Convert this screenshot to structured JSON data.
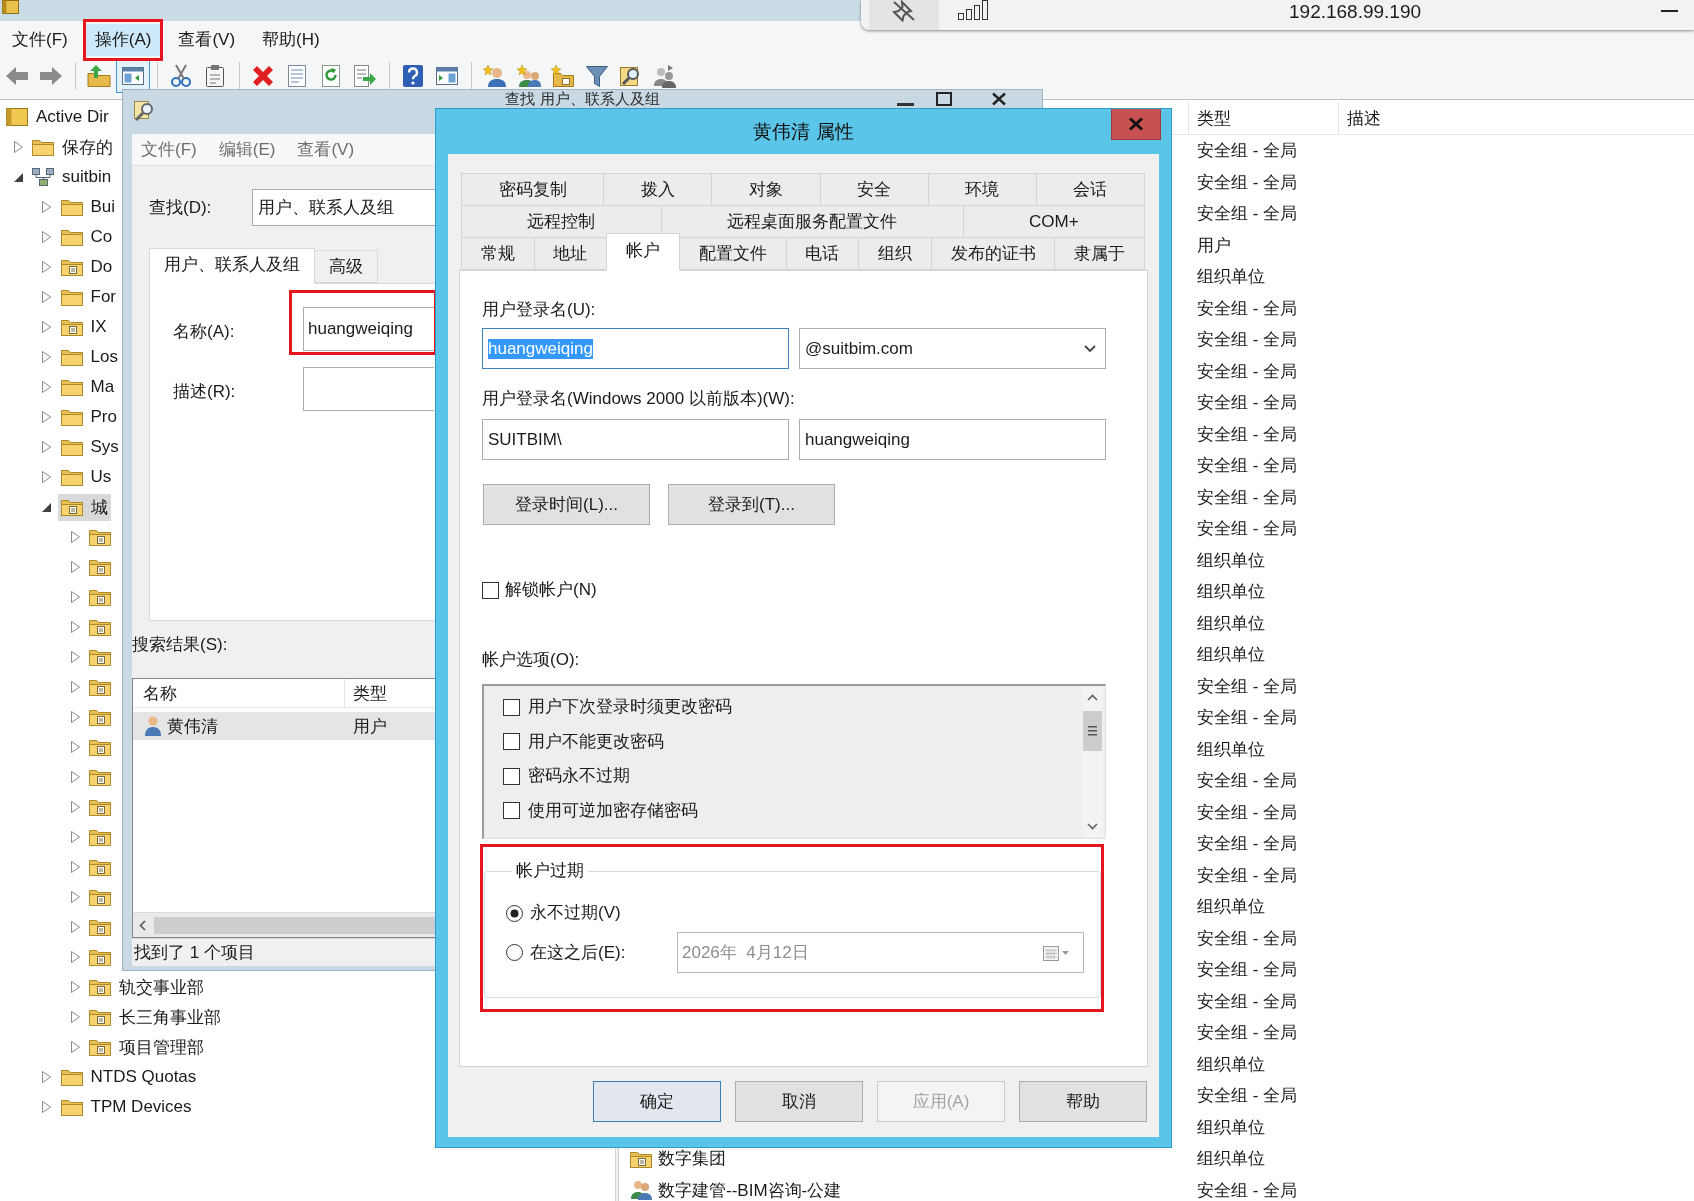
{
  "remote_bar": {
    "address": "192.168.99.190"
  },
  "menu": [
    {
      "label": "文件(F)",
      "selected": false,
      "annotated": false
    },
    {
      "label": "操作(A)",
      "selected": true,
      "annotated": true
    },
    {
      "label": "查看(V)",
      "selected": false,
      "annotated": false
    },
    {
      "label": "帮助(H)",
      "selected": false,
      "annotated": false
    }
  ],
  "toolbar": [
    {
      "kind": "back",
      "pressed": false
    },
    {
      "kind": "forward",
      "pressed": false
    },
    {
      "kind": "separator"
    },
    {
      "kind": "up",
      "pressed": false
    },
    {
      "kind": "tree",
      "pressed": true
    },
    {
      "kind": "separator"
    },
    {
      "kind": "cut",
      "pressed": false
    },
    {
      "kind": "paste",
      "pressed": false
    },
    {
      "kind": "separator"
    },
    {
      "kind": "delete",
      "pressed": false
    },
    {
      "kind": "properties",
      "pressed": false
    },
    {
      "kind": "refresh",
      "pressed": false
    },
    {
      "kind": "export",
      "pressed": false
    },
    {
      "kind": "separator"
    },
    {
      "kind": "help",
      "pressed": false
    },
    {
      "kind": "actionpane",
      "pressed": false
    },
    {
      "kind": "separator"
    },
    {
      "kind": "newuser",
      "pressed": false
    },
    {
      "kind": "newgroup",
      "pressed": false
    },
    {
      "kind": "newou",
      "pressed": false
    },
    {
      "kind": "filter",
      "pressed": false
    },
    {
      "kind": "find",
      "pressed": false
    },
    {
      "kind": "delegate",
      "pressed": false
    }
  ],
  "tree": [
    {
      "label": "Active Dir",
      "kind": "book",
      "selected": false,
      "children": [
        {
          "label": "保存的",
          "kind": "folder",
          "expanded": false,
          "selected": false
        },
        {
          "label": "suitbin",
          "kind": "domain",
          "expanded": true,
          "selected": false,
          "children": [
            {
              "label": "Bui",
              "kind": "folder",
              "expanded": false,
              "selected": false
            },
            {
              "label": "Co",
              "kind": "folder",
              "expanded": false,
              "selected": false
            },
            {
              "label": "Do",
              "kind": "ou",
              "expanded": false,
              "selected": false
            },
            {
              "label": "For",
              "kind": "folder",
              "expanded": false,
              "selected": false
            },
            {
              "label": "IX",
              "kind": "ou",
              "expanded": false,
              "selected": false
            },
            {
              "label": "Los",
              "kind": "folder",
              "expanded": false,
              "selected": false
            },
            {
              "label": "Ma",
              "kind": "folder",
              "expanded": false,
              "selected": false
            },
            {
              "label": "Pro",
              "kind": "folder",
              "expanded": false,
              "selected": false
            },
            {
              "label": "Sys",
              "kind": "folder",
              "expanded": false,
              "selected": false
            },
            {
              "label": "Us",
              "kind": "folder",
              "expanded": false,
              "selected": false
            },
            {
              "label": "城",
              "kind": "ou",
              "expanded": true,
              "selected": true,
              "children": [
                {
                  "kind": "ou",
                  "expanded": false,
                  "selected": false
                },
                {
                  "kind": "ou",
                  "expanded": false,
                  "selected": false
                },
                {
                  "kind": "ou",
                  "expanded": false,
                  "selected": false
                },
                {
                  "kind": "ou",
                  "expanded": false,
                  "selected": false
                },
                {
                  "kind": "ou",
                  "expanded": false,
                  "selected": false
                },
                {
                  "kind": "ou",
                  "expanded": false,
                  "selected": false
                },
                {
                  "kind": "ou",
                  "expanded": false,
                  "selected": false
                },
                {
                  "kind": "ou",
                  "expanded": false,
                  "selected": false
                },
                {
                  "kind": "ou",
                  "expanded": false,
                  "selected": false
                },
                {
                  "kind": "ou",
                  "expanded": false,
                  "selected": false
                },
                {
                  "kind": "ou",
                  "expanded": false,
                  "selected": false
                },
                {
                  "kind": "ou",
                  "expanded": false,
                  "selected": false
                },
                {
                  "kind": "ou",
                  "expanded": false,
                  "selected": false
                },
                {
                  "kind": "ou",
                  "expanded": false,
                  "selected": false
                },
                {
                  "kind": "ou",
                  "expanded": false,
                  "selected": false
                },
                {
                  "label": "轨交事业部",
                  "kind": "ou",
                  "expanded": false,
                  "selected": false
                },
                {
                  "label": "长三角事业部",
                  "kind": "ou",
                  "expanded": false,
                  "selected": false
                },
                {
                  "label": "项目管理部",
                  "kind": "ou",
                  "expanded": false,
                  "selected": false
                }
              ]
            },
            {
              "label": "NTDS Quotas",
              "kind": "folder",
              "expanded": false,
              "selected": false
            },
            {
              "label": "TPM Devices",
              "kind": "folder",
              "expanded": false,
              "selected": false
            }
          ]
        }
      ]
    }
  ],
  "list": {
    "columns": [
      "类型",
      "描述"
    ],
    "rows": [
      {
        "type": "安全组 - 全局"
      },
      {
        "type": "安全组 - 全局"
      },
      {
        "type": "安全组 - 全局"
      },
      {
        "type": "用户"
      },
      {
        "type": "组织单位"
      },
      {
        "type": "安全组 - 全局"
      },
      {
        "type": "安全组 - 全局"
      },
      {
        "type": "安全组 - 全局"
      },
      {
        "type": "安全组 - 全局"
      },
      {
        "type": "安全组 - 全局"
      },
      {
        "type": "安全组 - 全局"
      },
      {
        "type": "安全组 - 全局"
      },
      {
        "type": "安全组 - 全局"
      },
      {
        "type": "组织单位"
      },
      {
        "type": "组织单位"
      },
      {
        "type": "组织单位"
      },
      {
        "type": "组织单位"
      },
      {
        "type": "安全组 - 全局"
      },
      {
        "type": "安全组 - 全局"
      },
      {
        "type": "组织单位"
      },
      {
        "type": "安全组 - 全局"
      },
      {
        "type": "安全组 - 全局"
      },
      {
        "type": "安全组 - 全局"
      },
      {
        "type": "安全组 - 全局"
      },
      {
        "type": "组织单位"
      },
      {
        "type": "安全组 - 全局"
      },
      {
        "type": "安全组 - 全局"
      },
      {
        "type": "安全组 - 全局"
      },
      {
        "type": "安全组 - 全局"
      },
      {
        "type": "组织单位"
      },
      {
        "type": "安全组 - 全局"
      },
      {
        "type": "组织单位"
      },
      {
        "name": "数字集团",
        "kind": "ou",
        "type": "组织单位"
      },
      {
        "name": "数字建管--BIM咨询-公建",
        "kind": "group",
        "type": "安全组 - 全局"
      }
    ]
  },
  "find_dialog": {
    "title": "查找 用户、联系人及组",
    "menu": [
      "文件(F)",
      "编辑(E)",
      "查看(V)"
    ],
    "find_label": "查找(D):",
    "find_value": "用户、联系人及组",
    "tabs": [
      {
        "label": "用户、联系人及组",
        "selected": true
      },
      {
        "label": "高级",
        "selected": false
      }
    ],
    "fields": [
      {
        "label": "名称(A):",
        "value": "huangweiqing",
        "annotated": true
      },
      {
        "label": "描述(R):",
        "annotated": false
      }
    ],
    "results_label": "搜索结果(S):",
    "results": {
      "columns": [
        "名称",
        "类型"
      ],
      "rows": [
        {
          "name": "黄伟清",
          "type": "用户",
          "selected": true
        }
      ]
    },
    "status": "找到了 1 个项目"
  },
  "properties_dialog": {
    "title": "黄伟清 属性",
    "tab_rows": [
      [
        {
          "label": "密码复制",
          "selected": false
        },
        {
          "label": "拨入",
          "selected": false
        },
        {
          "label": "对象",
          "selected": false
        },
        {
          "label": "安全",
          "selected": false
        },
        {
          "label": "环境",
          "selected": false
        },
        {
          "label": "会话",
          "selected": false
        }
      ],
      [
        {
          "label": "远程控制",
          "selected": false
        },
        {
          "label": "远程桌面服务配置文件",
          "selected": false
        },
        {
          "label": "COM+",
          "selected": false
        }
      ],
      [
        {
          "label": "常规",
          "selected": false
        },
        {
          "label": "地址",
          "selected": false
        },
        {
          "label": "帐户",
          "selected": true
        },
        {
          "label": "配置文件",
          "selected": false
        },
        {
          "label": "电话",
          "selected": false
        },
        {
          "label": "组织",
          "selected": false
        },
        {
          "label": "发布的证书",
          "selected": false
        },
        {
          "label": "隶属于",
          "selected": false
        }
      ]
    ],
    "logon_name": {
      "label": "用户登录名(U):",
      "value": "huangweiqing",
      "focused": true,
      "domain": "@suitbim.com"
    },
    "legacy_name": {
      "label": "用户登录名(Windows 2000 以前版本)(W):",
      "domain": "SUITBIM\\",
      "value": "huangweiqing"
    },
    "logon_buttons": [
      "登录时间(L)...",
      "登录到(T)..."
    ],
    "unlock": {
      "label": "解锁帐户(N)",
      "checked": false
    },
    "options": {
      "label": "帐户选项(O):",
      "items": [
        {
          "label": "用户下次登录时须更改密码",
          "checked": false
        },
        {
          "label": "用户不能更改密码",
          "checked": false
        },
        {
          "label": "密码永不过期",
          "checked": false
        },
        {
          "label": "使用可逆加密存储密码",
          "checked": false
        }
      ]
    },
    "expiry": {
      "title": "帐户过期",
      "annotated": true,
      "choices": [
        {
          "label": "永不过期(V)",
          "selected": true
        },
        {
          "label": "在这之后(E):",
          "selected": false,
          "date": {
            "value": "2026年  4月12日",
            "disabled": true
          }
        }
      ]
    },
    "buttons": [
      {
        "label": "确定",
        "default": true,
        "disabled": false
      },
      {
        "label": "取消",
        "default": false,
        "disabled": false
      },
      {
        "label": "应用(A)",
        "default": false,
        "disabled": true
      },
      {
        "label": "帮助",
        "default": false,
        "disabled": false
      }
    ]
  }
}
